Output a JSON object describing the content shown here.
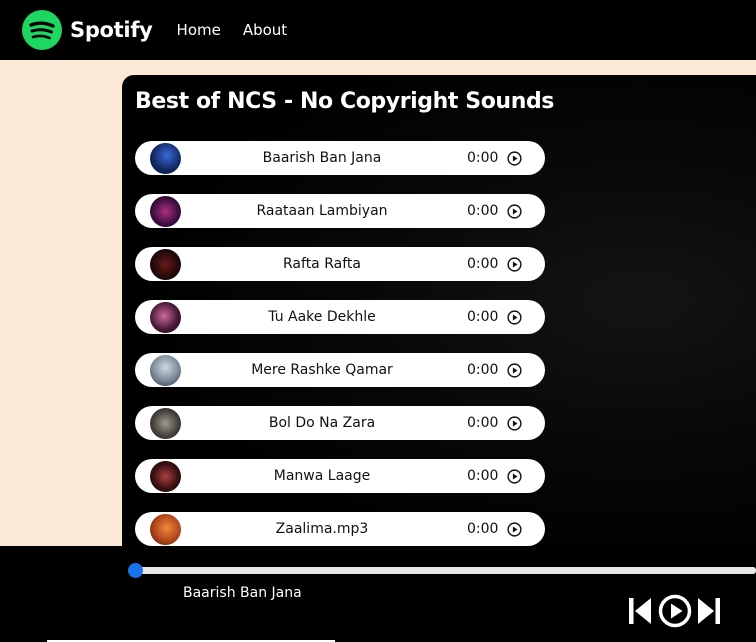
{
  "navbar": {
    "brand": "Spotify",
    "links": [
      "Home",
      "About"
    ]
  },
  "playlist": {
    "title": "Best of NCS - No Copyright Sounds",
    "songs": [
      {
        "name": "Baarish Ban Jana",
        "time": "0:00",
        "cover_color": "#1a3d8f"
      },
      {
        "name": "Raataan Lambiyan",
        "time": "0:00",
        "cover_color": "#5a1a5e"
      },
      {
        "name": "Rafta Rafta",
        "time": "0:00",
        "cover_color": "#2a0f0f"
      },
      {
        "name": "Tu Aake Dekhle",
        "time": "0:00",
        "cover_color": "#4a2a4a"
      },
      {
        "name": "Mere Rashke Qamar",
        "time": "0:00",
        "cover_color": "#8fa0b0"
      },
      {
        "name": "Bol Do Na Zara",
        "time": "0:00",
        "cover_color": "#5a5550"
      },
      {
        "name": "Manwa Laage",
        "time": "0:00",
        "cover_color": "#3a1a1a"
      },
      {
        "name": "Zaalima.mp3",
        "time": "0:00",
        "cover_color": "#e06a2a"
      }
    ]
  },
  "player": {
    "now_playing": "Baarish Ban Jana",
    "progress": 0,
    "accent": "#1a73e8",
    "controls": [
      "previous-icon",
      "play-icon",
      "next-icon"
    ]
  }
}
